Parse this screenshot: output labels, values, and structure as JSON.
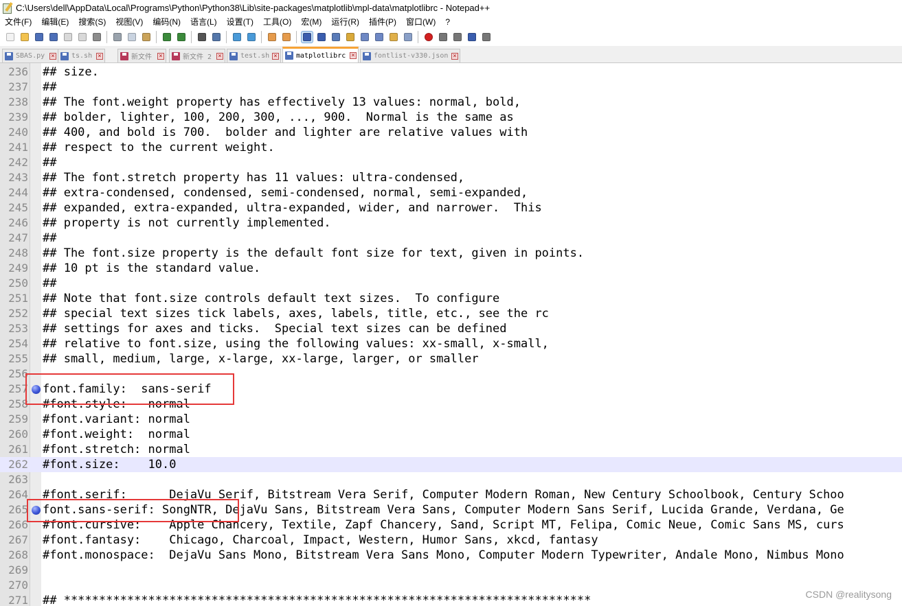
{
  "window": {
    "title": "C:\\Users\\dell\\AppData\\Local\\Programs\\Python\\Python38\\Lib\\site-packages\\matplotlib\\mpl-data\\matplotlibrc - Notepad++"
  },
  "menu": [
    "文件(F)",
    "编辑(E)",
    "搜索(S)",
    "视图(V)",
    "编码(N)",
    "语言(L)",
    "设置(T)",
    "工具(O)",
    "宏(M)",
    "运行(R)",
    "插件(P)",
    "窗口(W)",
    "?"
  ],
  "toolbar": {
    "icons": [
      "new-file-icon",
      "open-file-icon",
      "save-icon",
      "save-all-icon",
      "close-icon",
      "close-all-icon",
      "print-icon",
      "sep",
      "cut-icon",
      "copy-icon",
      "paste-icon",
      "sep",
      "undo-icon",
      "redo-icon",
      "sep",
      "find-icon",
      "replace-icon",
      "sep",
      "zoom-in-icon",
      "zoom-out-icon",
      "sep",
      "sync-vertical-icon",
      "sync-horizontal-icon",
      "sep",
      "word-wrap-icon",
      "show-all-chars-icon",
      "indent-guide-icon",
      "user-language-icon",
      "doc-map-icon",
      "function-list-icon",
      "folder-workspace-icon",
      "monitoring-icon",
      "sep",
      "record-macro-icon",
      "stop-macro-icon",
      "play-macro-icon",
      "run-macro-multiple-icon",
      "save-macro-icon"
    ],
    "active_index": 24
  },
  "tabs": [
    {
      "label": "SBAS.py",
      "active": false,
      "unsaved": false
    },
    {
      "label": "ts.sh",
      "active": false,
      "unsaved": false
    },
    {
      "label": "新文件 1",
      "active": false,
      "unsaved": true
    },
    {
      "label": "新文件 2",
      "active": false,
      "unsaved": true
    },
    {
      "label": "test.sh",
      "active": false,
      "unsaved": false
    },
    {
      "label": "matplotlibrc",
      "active": true,
      "unsaved": false
    },
    {
      "label": "fontlist-v330.json",
      "active": false,
      "unsaved": false
    }
  ],
  "editor": {
    "current_line": 262,
    "bookmarks": [
      257,
      265
    ],
    "lines": [
      {
        "n": "236",
        "text": "## size."
      },
      {
        "n": "237",
        "text": "##"
      },
      {
        "n": "238",
        "text": "## The font.weight property has effectively 13 values: normal, bold,"
      },
      {
        "n": "239",
        "text": "## bolder, lighter, 100, 200, 300, ..., 900.  Normal is the same as"
      },
      {
        "n": "240",
        "text": "## 400, and bold is 700.  bolder and lighter are relative values with"
      },
      {
        "n": "241",
        "text": "## respect to the current weight."
      },
      {
        "n": "242",
        "text": "##"
      },
      {
        "n": "243",
        "text": "## The font.stretch property has 11 values: ultra-condensed,"
      },
      {
        "n": "244",
        "text": "## extra-condensed, condensed, semi-condensed, normal, semi-expanded,"
      },
      {
        "n": "245",
        "text": "## expanded, extra-expanded, ultra-expanded, wider, and narrower.  This"
      },
      {
        "n": "246",
        "text": "## property is not currently implemented."
      },
      {
        "n": "247",
        "text": "##"
      },
      {
        "n": "248",
        "text": "## The font.size property is the default font size for text, given in points."
      },
      {
        "n": "249",
        "text": "## 10 pt is the standard value."
      },
      {
        "n": "250",
        "text": "##"
      },
      {
        "n": "251",
        "text": "## Note that font.size controls default text sizes.  To configure"
      },
      {
        "n": "252",
        "text": "## special text sizes tick labels, axes, labels, title, etc., see the rc"
      },
      {
        "n": "253",
        "text": "## settings for axes and ticks.  Special text sizes can be defined"
      },
      {
        "n": "254",
        "text": "## relative to font.size, using the following values: xx-small, x-small,"
      },
      {
        "n": "255",
        "text": "## small, medium, large, x-large, xx-large, larger, or smaller"
      },
      {
        "n": "256",
        "text": ""
      },
      {
        "n": "257",
        "text": "font.family:  sans-serif"
      },
      {
        "n": "258",
        "text": "#font.style:   normal"
      },
      {
        "n": "259",
        "text": "#font.variant: normal"
      },
      {
        "n": "260",
        "text": "#font.weight:  normal"
      },
      {
        "n": "261",
        "text": "#font.stretch: normal"
      },
      {
        "n": "262",
        "text": "#font.size:    10.0"
      },
      {
        "n": "263",
        "text": ""
      },
      {
        "n": "264",
        "text": "#font.serif:      DejaVu Serif, Bitstream Vera Serif, Computer Modern Roman, New Century Schoolbook, Century Schoo"
      },
      {
        "n": "265",
        "text": "font.sans-serif: SongNTR, DejaVu Sans, Bitstream Vera Sans, Computer Modern Sans Serif, Lucida Grande, Verdana, Ge"
      },
      {
        "n": "266",
        "text": "#font.cursive:    Apple Chancery, Textile, Zapf Chancery, Sand, Script MT, Felipa, Comic Neue, Comic Sans MS, curs"
      },
      {
        "n": "267",
        "text": "#font.fantasy:    Chicago, Charcoal, Impact, Western, Humor Sans, xkcd, fantasy"
      },
      {
        "n": "268",
        "text": "#font.monospace:  DejaVu Sans Mono, Bitstream Vera Sans Mono, Computer Modern Typewriter, Andale Mono, Nimbus Mono"
      },
      {
        "n": "269",
        "text": ""
      },
      {
        "n": "270",
        "text": ""
      },
      {
        "n": "271",
        "text": "## ***************************************************************************"
      }
    ]
  },
  "watermark": "CSDN @realitysong"
}
